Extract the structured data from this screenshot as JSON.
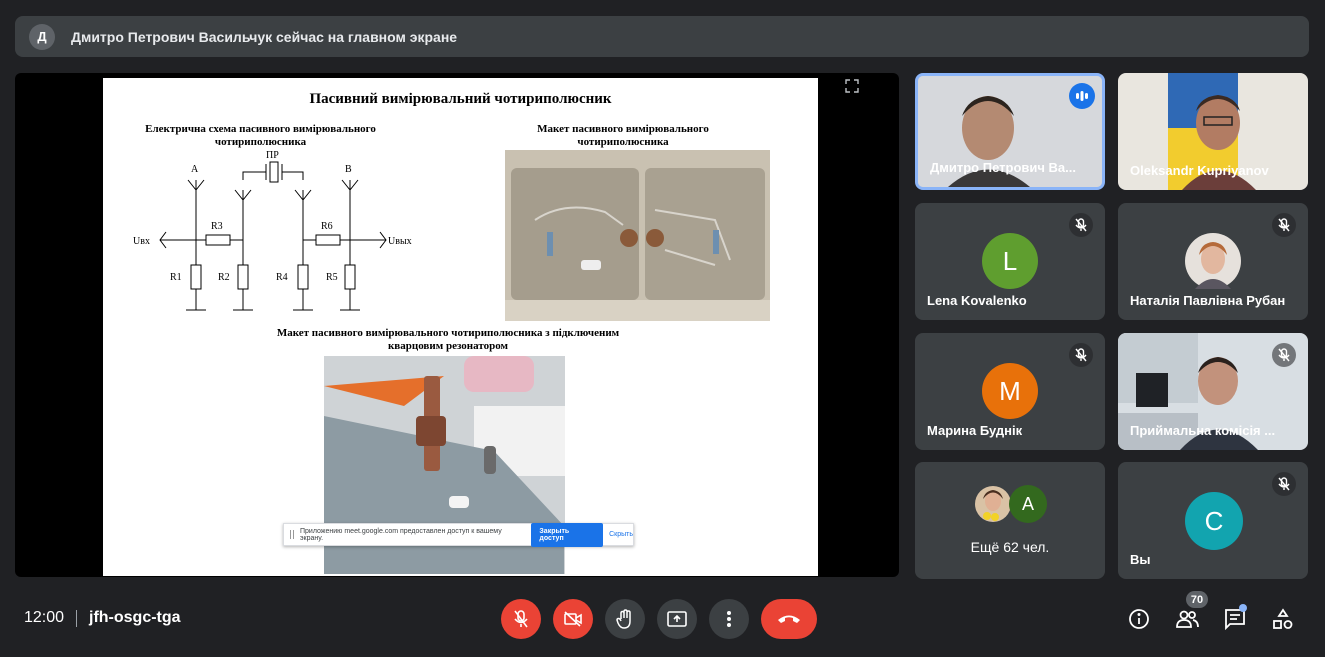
{
  "banner": {
    "avatar_letter": "Д",
    "text": "Дмитро Петрович Васильчук сейчас на главном экране"
  },
  "slide": {
    "title": "Пасивний вимірювальний чотириполюсник",
    "caption_schematic": "Електрична схема пасивного вимірювального чотириполюсника",
    "caption_photo1": "Макет пасивного вимірювального чотириполюсника",
    "caption_photo2": "Макет пасивного вимірювального чотириполюсника з підключеним кварцовим резонатором",
    "schematic_labels": {
      "pr": "ПР",
      "a": "A",
      "b": "B",
      "r1": "R1",
      "r2": "R2",
      "r3": "R3",
      "r4": "R4",
      "r5": "R5",
      "r6": "R6",
      "uin": "Uвх",
      "uout": "Uвых"
    }
  },
  "share_notice": {
    "text": "Приложению meet.google.com предоставлен доступ к вашему экрану.",
    "stop_button": "Закрыть доступ",
    "hide_link": "Скрыть"
  },
  "participants": [
    {
      "name": "Дмитро Петрович Ва...",
      "state": "speaking"
    },
    {
      "name": "Oleksandr Kupriyanov",
      "state": "video"
    },
    {
      "name": "Lena Kovalenko",
      "initial": "L",
      "color": "#5f9e2f",
      "muted": true
    },
    {
      "name": "Наталія Павлівна Рубан",
      "muted": true
    },
    {
      "name": "Марина Буднік",
      "initial": "M",
      "color": "#e8710a",
      "muted": true
    },
    {
      "name": "Приймальна комісія ...",
      "muted": true
    },
    {
      "name": "Ещё 62 чел.",
      "extra_initial": "A"
    },
    {
      "name": "Вы",
      "initial": "C",
      "color": "#12a4af",
      "muted": true
    }
  ],
  "bottom_bar": {
    "time": "12:00",
    "meeting_code": "jfh-osgc-tga",
    "participant_count": "70"
  }
}
